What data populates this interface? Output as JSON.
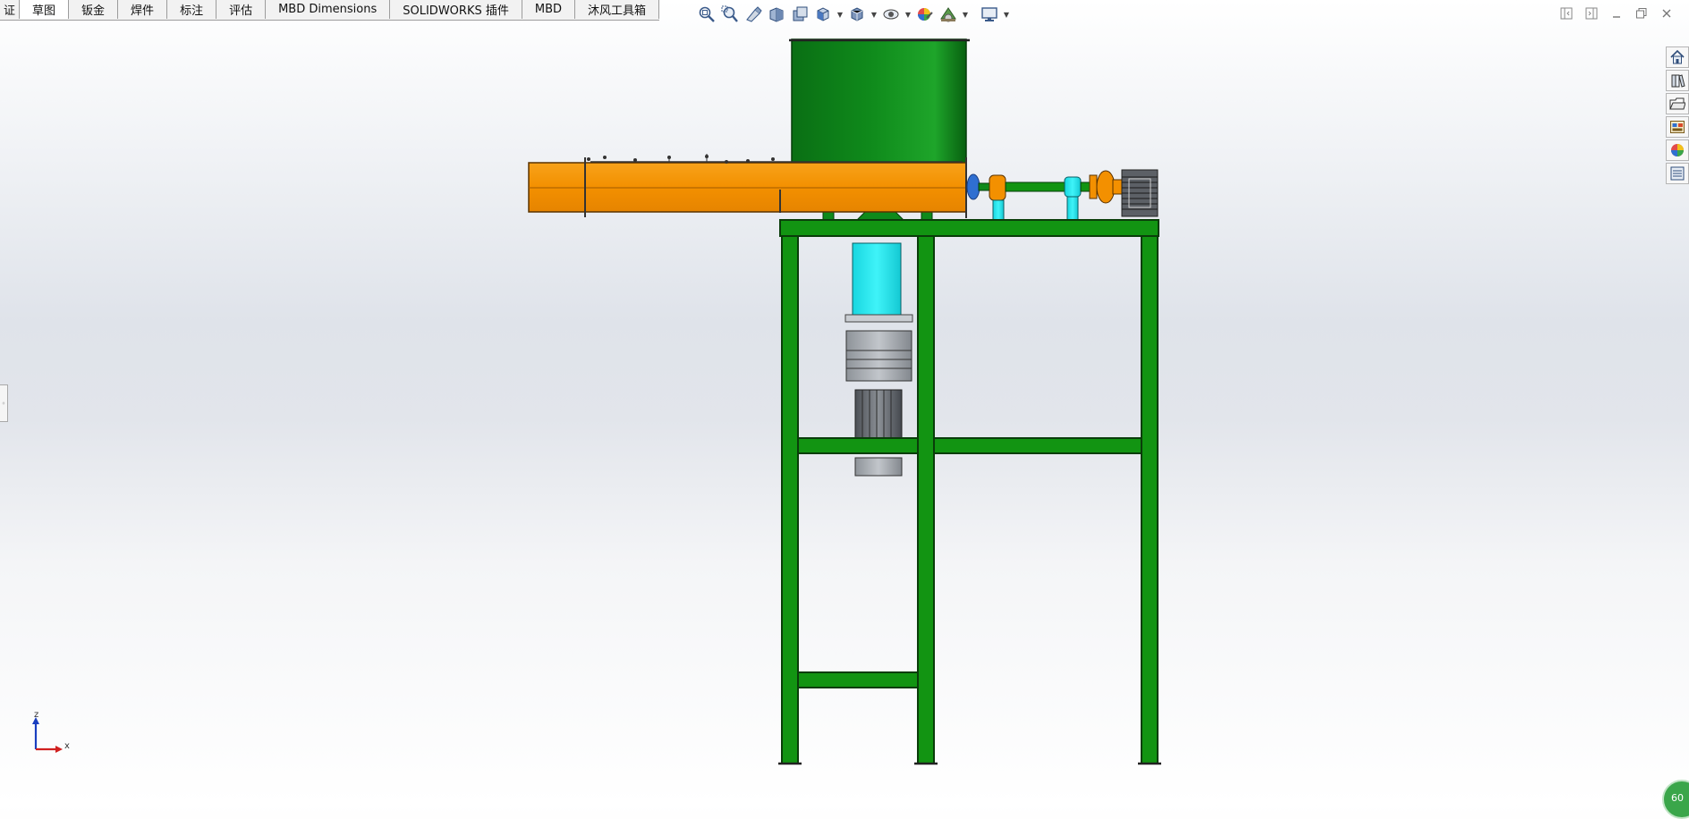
{
  "ribbon_tabs": [
    {
      "label": "证"
    },
    {
      "label": "草图"
    },
    {
      "label": "钣金"
    },
    {
      "label": "焊件"
    },
    {
      "label": "标注"
    },
    {
      "label": "评估"
    },
    {
      "label": "MBD Dimensions"
    },
    {
      "label": "SOLIDWORKS 插件"
    },
    {
      "label": "MBD"
    },
    {
      "label": "沐风工具箱"
    }
  ],
  "active_tab_index": 1,
  "heads_up_toolbar": [
    {
      "icon": "zoom-to-fit-icon"
    },
    {
      "icon": "zoom-to-area-icon"
    },
    {
      "icon": "previous-view-icon"
    },
    {
      "icon": "section-view-icon"
    },
    {
      "icon": "dynamic-annotation-icon"
    },
    {
      "icon": "view-orientation-icon",
      "dropdown": true
    },
    {
      "icon": "display-style-icon",
      "dropdown": true
    },
    {
      "icon": "hide-show-items-icon",
      "dropdown": true
    },
    {
      "icon": "edit-appearance-icon"
    },
    {
      "icon": "apply-scene-icon",
      "dropdown": true
    },
    {
      "icon": "view-settings-icon",
      "dropdown": true
    }
  ],
  "triad": {
    "z_label": "z",
    "x_label": "x"
  },
  "status_badge": {
    "text": "60"
  },
  "colors": {
    "hopper": "#0b7c17",
    "frame": "#129412",
    "screw_tube": "#f59a0c",
    "cyan": "#19e6ee",
    "motor": "#6e7278"
  }
}
